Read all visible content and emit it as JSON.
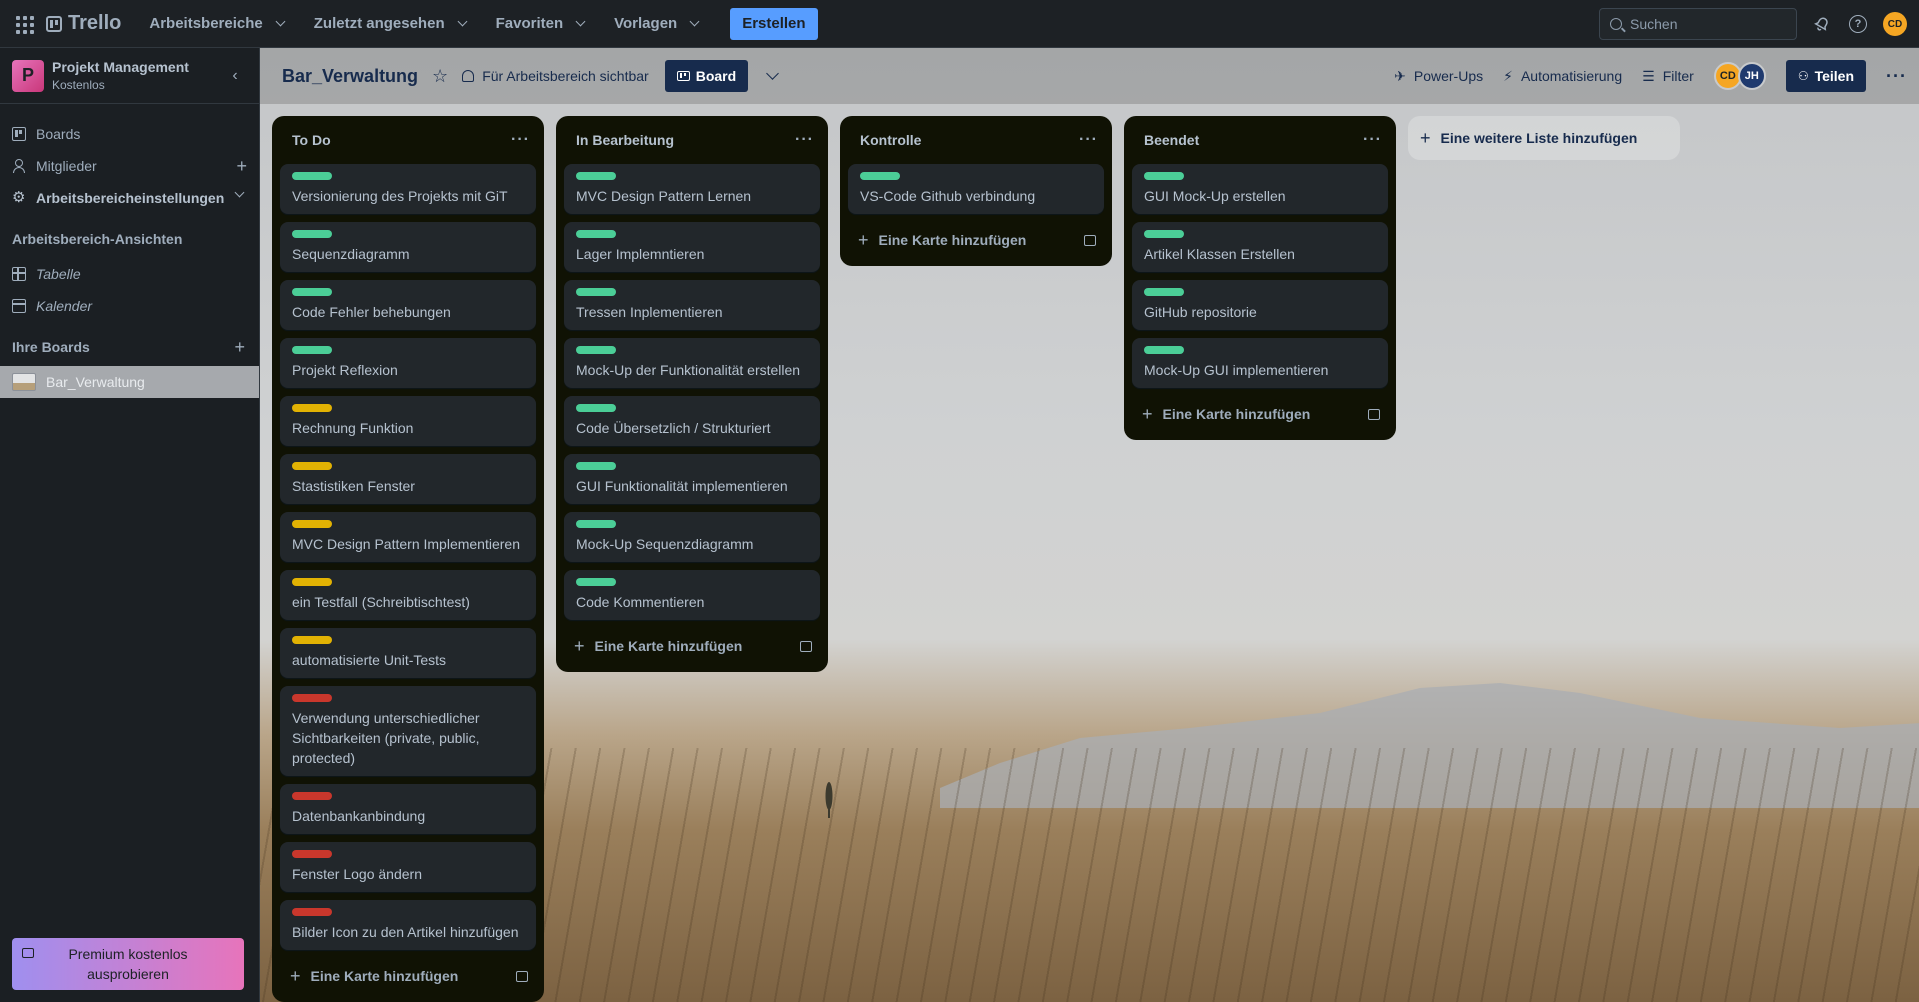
{
  "topnav": {
    "app_name": "Trello",
    "menus": [
      "Arbeitsbereiche",
      "Zuletzt angesehen",
      "Favoriten",
      "Vorlagen"
    ],
    "create_label": "Erstellen",
    "search_placeholder": "Suchen",
    "user_initials": "CD"
  },
  "sidebar": {
    "workspace_name": "Projekt Management",
    "workspace_initial": "P",
    "workspace_plan": "Kostenlos",
    "items": [
      "Boards",
      "Mitglieder",
      "Arbeitsbereicheinstellungen"
    ],
    "views_heading": "Arbeitsbereich-Ansichten",
    "views": [
      "Tabelle",
      "Kalender"
    ],
    "boards_heading": "Ihre Boards",
    "boards": [
      "Bar_Verwaltung"
    ],
    "premium_label": "Premium kostenlos ausprobieren"
  },
  "boardbar": {
    "title": "Bar_Verwaltung",
    "visibility": "Für Arbeitsbereich sichtbar",
    "view": "Board",
    "powerups": "Power-Ups",
    "automation": "Automatisierung",
    "filter": "Filter",
    "members": [
      "CD",
      "JH"
    ],
    "share": "Teilen"
  },
  "colors": {
    "green": "#4bce97",
    "yellow": "#e2b203",
    "red": "#c9372c"
  },
  "lists": [
    {
      "title": "To Do",
      "add_label": "Eine Karte hinzufügen",
      "cards": [
        {
          "label": "green",
          "title": "Versionierung des Projekts mit GiT"
        },
        {
          "label": "green",
          "title": "Sequenzdiagramm"
        },
        {
          "label": "green",
          "title": "Code Fehler behebungen"
        },
        {
          "label": "green",
          "title": "Projekt Reflexion"
        },
        {
          "label": "yellow",
          "title": "Rechnung Funktion"
        },
        {
          "label": "yellow",
          "title": "Stastistiken Fenster"
        },
        {
          "label": "yellow",
          "title": "MVC Design Pattern Implementieren"
        },
        {
          "label": "yellow",
          "title": "ein Testfall (Schreibtischtest)"
        },
        {
          "label": "yellow",
          "title": "automatisierte Unit-Tests"
        },
        {
          "label": "red",
          "title": "Verwendung unterschiedlicher Sichtbarkeiten (private, public, protected)"
        },
        {
          "label": "red",
          "title": "Datenbankanbindung"
        },
        {
          "label": "red",
          "title": "Fenster Logo ändern"
        },
        {
          "label": "red",
          "title": "Bilder Icon zu den Artikel hinzufügen"
        }
      ]
    },
    {
      "title": "In Bearbeitung",
      "add_label": "Eine Karte hinzufügen",
      "cards": [
        {
          "label": "green",
          "title": "MVC Design Pattern Lernen"
        },
        {
          "label": "green",
          "title": "Lager Implemntieren"
        },
        {
          "label": "green",
          "title": "Tressen Inplementieren"
        },
        {
          "label": "green",
          "title": "Mock-Up der Funktionalität erstellen"
        },
        {
          "label": "green",
          "title": "Code Übersetzlich / Strukturiert"
        },
        {
          "label": "green",
          "title": "GUI Funktionalität implementieren"
        },
        {
          "label": "green",
          "title": "Mock-Up Sequenzdiagramm"
        },
        {
          "label": "green",
          "title": "Code Kommentieren"
        }
      ]
    },
    {
      "title": "Kontrolle",
      "add_label": "Eine Karte hinzufügen",
      "cards": [
        {
          "label": "green",
          "title": "VS-Code Github verbindung"
        }
      ]
    },
    {
      "title": "Beendet",
      "add_label": "Eine Karte hinzufügen",
      "cards": [
        {
          "label": "green",
          "title": "GUI Mock-Up erstellen"
        },
        {
          "label": "green",
          "title": "Artikel Klassen Erstellen"
        },
        {
          "label": "green",
          "title": "GitHub repositorie"
        },
        {
          "label": "green",
          "title": "Mock-Up GUI implementieren"
        }
      ]
    }
  ],
  "add_list_label": "Eine weitere Liste hinzufügen"
}
